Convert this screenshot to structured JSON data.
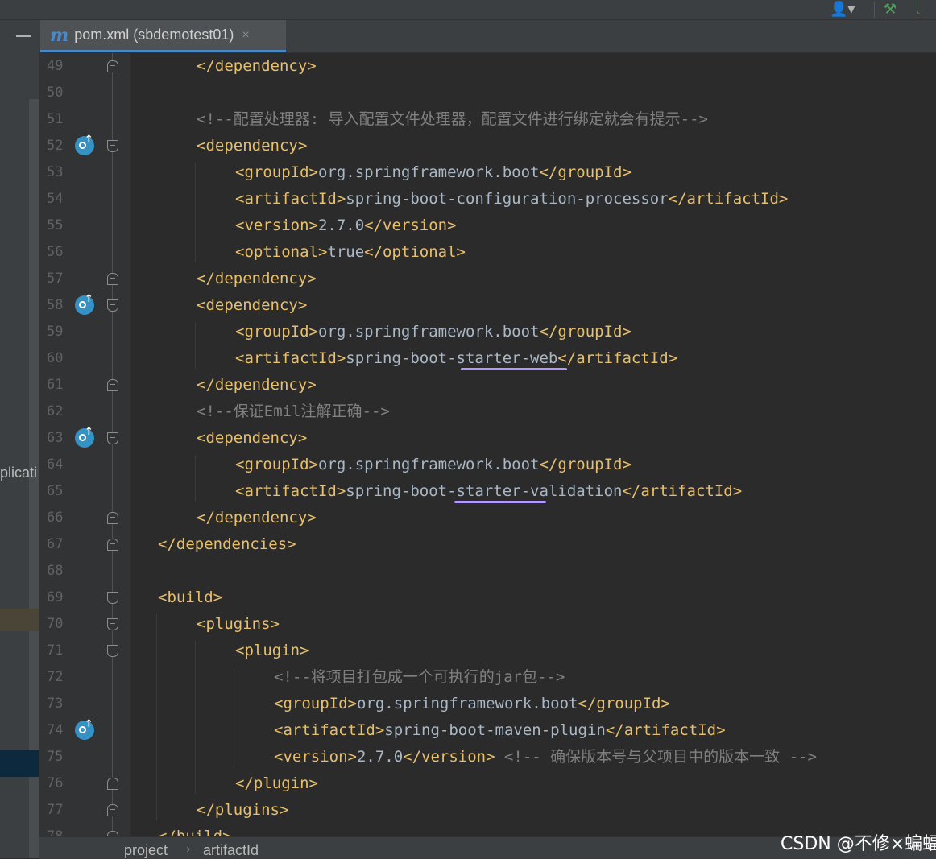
{
  "tab": {
    "icon": "maven-m-icon",
    "label": "pom.xml (sbdemotest01)",
    "close": "×"
  },
  "left_panel": {
    "label": "plicati"
  },
  "breadcrumb": {
    "items": [
      "project",
      "artifactId"
    ],
    "separator": "›"
  },
  "watermark": "CSDN @不修×蝙蝠",
  "lines": [
    {
      "n": "49",
      "indent": 2,
      "parts": [
        {
          "t": "tag",
          "v": "</dependency>"
        }
      ]
    },
    {
      "n": "50",
      "indent": 0,
      "parts": []
    },
    {
      "n": "51",
      "indent": 2,
      "parts": [
        {
          "t": "cmt",
          "v": "<!--配置处理器: 导入配置文件处理器，配置文件进行绑定就会有提示-->"
        }
      ]
    },
    {
      "n": "52",
      "indent": 2,
      "parts": [
        {
          "t": "tag",
          "v": "<dependency>"
        }
      ]
    },
    {
      "n": "53",
      "indent": 3,
      "parts": [
        {
          "t": "tag",
          "v": "<groupId>"
        },
        {
          "t": "txt",
          "v": "org.springframework.boot"
        },
        {
          "t": "tag",
          "v": "</groupId>"
        }
      ]
    },
    {
      "n": "54",
      "indent": 3,
      "parts": [
        {
          "t": "tag",
          "v": "<artifactId>"
        },
        {
          "t": "txt",
          "v": "spring-boot-configuration-processor"
        },
        {
          "t": "tag",
          "v": "</artifactId>"
        }
      ]
    },
    {
      "n": "55",
      "indent": 3,
      "parts": [
        {
          "t": "tag",
          "v": "<version>"
        },
        {
          "t": "txt",
          "v": "2.7.0"
        },
        {
          "t": "tag",
          "v": "</version>"
        }
      ]
    },
    {
      "n": "56",
      "indent": 3,
      "parts": [
        {
          "t": "tag",
          "v": "<optional>"
        },
        {
          "t": "txt",
          "v": "true"
        },
        {
          "t": "tag",
          "v": "</optional>"
        }
      ]
    },
    {
      "n": "57",
      "indent": 2,
      "parts": [
        {
          "t": "tag",
          "v": "</dependency>"
        }
      ]
    },
    {
      "n": "58",
      "indent": 2,
      "parts": [
        {
          "t": "tag",
          "v": "<dependency>"
        }
      ]
    },
    {
      "n": "59",
      "indent": 3,
      "parts": [
        {
          "t": "tag",
          "v": "<groupId>"
        },
        {
          "t": "txt",
          "v": "org.springframework.boot"
        },
        {
          "t": "tag",
          "v": "</groupId>"
        }
      ]
    },
    {
      "n": "60",
      "indent": 3,
      "parts": [
        {
          "t": "tag",
          "v": "<artifactId>"
        },
        {
          "t": "txt",
          "v": "spring-boot-starter-web"
        },
        {
          "t": "tag",
          "v": "</artifactId>"
        }
      ]
    },
    {
      "n": "61",
      "indent": 2,
      "parts": [
        {
          "t": "tag",
          "v": "</dependency>"
        }
      ]
    },
    {
      "n": "62",
      "indent": 2,
      "parts": [
        {
          "t": "cmt",
          "v": "<!--保证Emil注解正确-->"
        }
      ]
    },
    {
      "n": "63",
      "indent": 2,
      "parts": [
        {
          "t": "tag",
          "v": "<dependency>"
        }
      ]
    },
    {
      "n": "64",
      "indent": 3,
      "parts": [
        {
          "t": "tag",
          "v": "<groupId>"
        },
        {
          "t": "txt",
          "v": "org.springframework.boot"
        },
        {
          "t": "tag",
          "v": "</groupId>"
        }
      ]
    },
    {
      "n": "65",
      "indent": 3,
      "parts": [
        {
          "t": "tag",
          "v": "<artifactId>"
        },
        {
          "t": "txt",
          "v": "spring-boot-starter-validation"
        },
        {
          "t": "tag",
          "v": "</artifactId>"
        }
      ]
    },
    {
      "n": "66",
      "indent": 2,
      "parts": [
        {
          "t": "tag",
          "v": "</dependency>"
        }
      ]
    },
    {
      "n": "67",
      "indent": 1,
      "parts": [
        {
          "t": "tag",
          "v": "</dependencies>"
        }
      ]
    },
    {
      "n": "68",
      "indent": 0,
      "parts": []
    },
    {
      "n": "69",
      "indent": 1,
      "parts": [
        {
          "t": "tag",
          "v": "<build>"
        }
      ]
    },
    {
      "n": "70",
      "indent": 2,
      "parts": [
        {
          "t": "tag",
          "v": "<plugins>"
        }
      ]
    },
    {
      "n": "71",
      "indent": 3,
      "parts": [
        {
          "t": "tag",
          "v": "<plugin>"
        }
      ]
    },
    {
      "n": "72",
      "indent": 4,
      "parts": [
        {
          "t": "cmt",
          "v": "<!--将项目打包成一个可执行的jar包-->"
        }
      ]
    },
    {
      "n": "73",
      "indent": 4,
      "parts": [
        {
          "t": "tag",
          "v": "<groupId>"
        },
        {
          "t": "txt",
          "v": "org.springframework.boot"
        },
        {
          "t": "tag",
          "v": "</groupId>"
        }
      ]
    },
    {
      "n": "74",
      "indent": 4,
      "parts": [
        {
          "t": "tag",
          "v": "<artifactId>"
        },
        {
          "t": "txt",
          "v": "spring-boot-maven-plugin"
        },
        {
          "t": "tag",
          "v": "</artifactId>"
        }
      ]
    },
    {
      "n": "75",
      "indent": 4,
      "parts": [
        {
          "t": "tag",
          "v": "<version>"
        },
        {
          "t": "txt",
          "v": "2.7.0"
        },
        {
          "t": "tag",
          "v": "</version>"
        },
        {
          "t": "cmt",
          "v": " <!-- 确保版本号与父项目中的版本一致 -->"
        }
      ]
    },
    {
      "n": "76",
      "indent": 3,
      "parts": [
        {
          "t": "tag",
          "v": "</plugin>"
        }
      ]
    },
    {
      "n": "77",
      "indent": 2,
      "parts": [
        {
          "t": "tag",
          "v": "</plugins>"
        }
      ]
    },
    {
      "n": "78",
      "indent": 1,
      "parts": [
        {
          "t": "tag",
          "v": "</build>"
        }
      ]
    }
  ],
  "fold_markers": [
    {
      "line": "49",
      "kind": "close"
    },
    {
      "line": "52",
      "kind": "open"
    },
    {
      "line": "57",
      "kind": "close"
    },
    {
      "line": "58",
      "kind": "open"
    },
    {
      "line": "61",
      "kind": "close"
    },
    {
      "line": "63",
      "kind": "open"
    },
    {
      "line": "66",
      "kind": "close"
    },
    {
      "line": "67",
      "kind": "close"
    },
    {
      "line": "69",
      "kind": "open"
    },
    {
      "line": "70",
      "kind": "open"
    },
    {
      "line": "71",
      "kind": "open"
    },
    {
      "line": "76",
      "kind": "close"
    },
    {
      "line": "77",
      "kind": "close"
    },
    {
      "line": "78",
      "kind": "close"
    }
  ],
  "maven_markers": [
    "52",
    "58",
    "63",
    "74"
  ],
  "highlighted_lines": [
    "60",
    "65"
  ]
}
